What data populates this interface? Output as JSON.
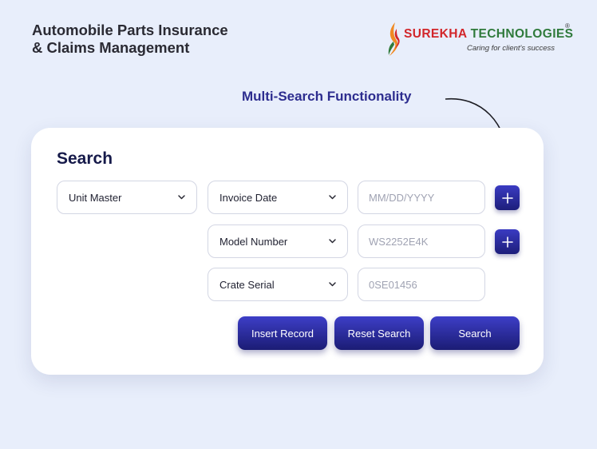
{
  "header": {
    "title_line1": "Automobile Parts Insurance",
    "title_line2": "& Claims Management"
  },
  "brand": {
    "name_part1": "SUREKHA",
    "name_part2": " TECHNOLOGIES",
    "registered": "®",
    "tagline": "Caring for client's success",
    "colors": {
      "red": "#d2262a",
      "green": "#2f7a3b",
      "orange": "#f08a24"
    }
  },
  "callout": {
    "text": "Multi-Search Functionality",
    "color": "#2d2d8f"
  },
  "search_panel": {
    "title": "Search",
    "unit_dropdown": {
      "value": "Unit Master",
      "icon": "chevron-down-icon"
    },
    "rows": [
      {
        "field": "Invoice Date",
        "placeholder": "MM/DD/YYYY",
        "has_add": true
      },
      {
        "field": "Model Number",
        "placeholder": "WS2252E4K",
        "has_add": true
      },
      {
        "field": "Crate Serial",
        "placeholder": "0SE01456",
        "has_add": false
      }
    ],
    "buttons": {
      "insert": "Insert Record",
      "reset": "Reset Search",
      "search": "Search"
    },
    "accent_color": "#2b2ca6"
  }
}
